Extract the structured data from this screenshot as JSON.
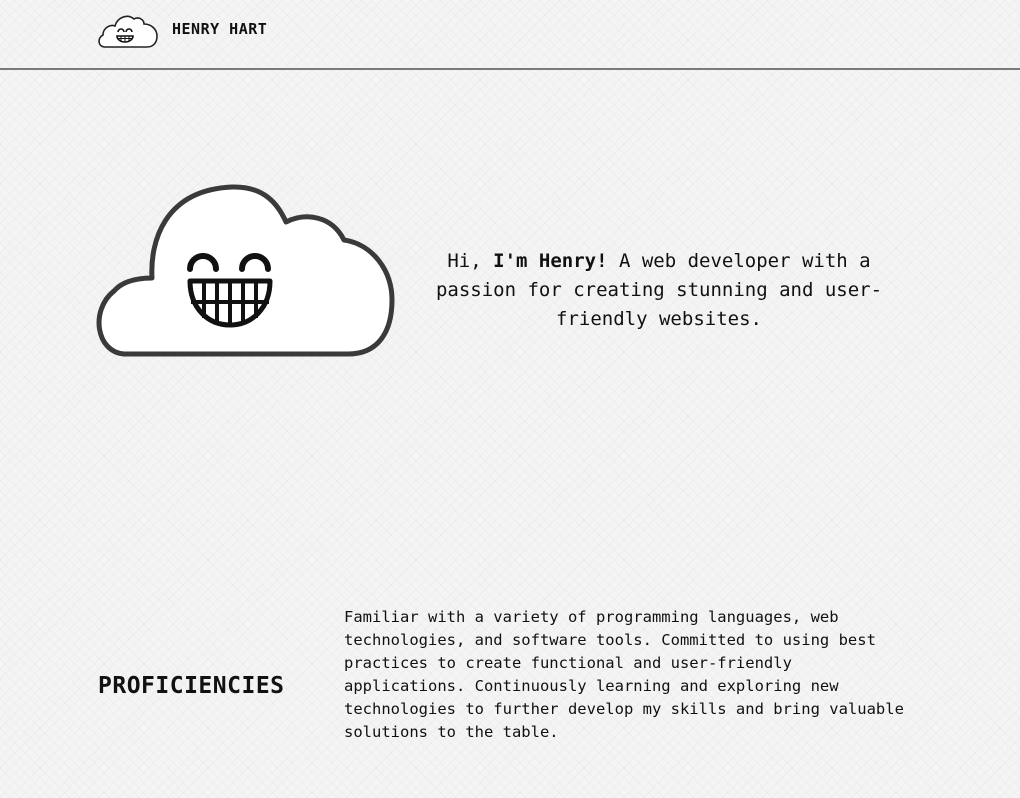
{
  "header": {
    "logo_icon": "grinning-cloud-icon",
    "brand_name": "HENRY HART"
  },
  "hero": {
    "illustration": "grinning-cloud-icon",
    "greeting": "Hi, ",
    "name": "I'm Henry!",
    "tagline": " A web developer with a passion for creating stunning and user-friendly websites."
  },
  "proficiencies": {
    "title": "PROFICIENCIES",
    "description": "Familiar with a variety of programming languages, web technologies, and software tools. Committed to using best practices to create functional and user-friendly applications. Continuously learning and exploring new technologies to further develop my skills and bring valuable solutions to the table."
  },
  "colors": {
    "background": "#f4f4f4",
    "text": "#111111",
    "divider": "#7a7a7a",
    "cloud_outline": "#3a3a3a"
  }
}
